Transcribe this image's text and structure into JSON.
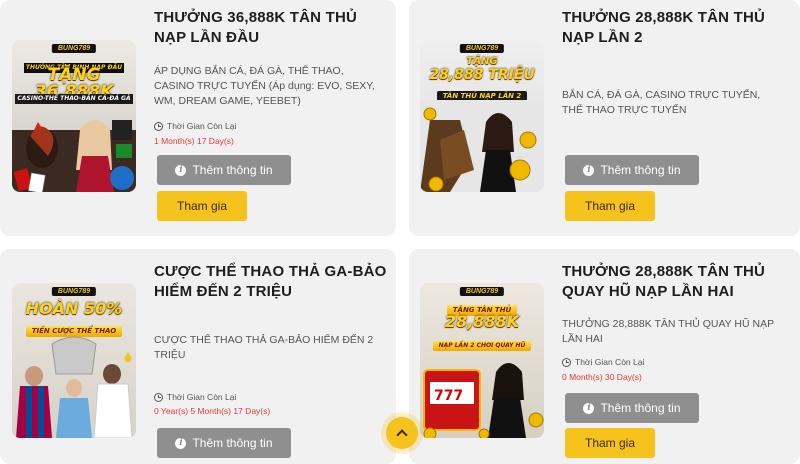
{
  "promotions": [
    {
      "title": "THƯỞNG 36,888K TÂN THỦ NẠP LẦN ĐẦU",
      "description": "ÁP DỤNG BẮN CÁ, ĐÁ GÀ, THỂ THAO, CASINO TRỰC TUYẾN (Áp dụng: EVO, SEXY, WM, DREAM GAME, YEEBET)",
      "timer_label": "Thời Gian Còn Lại",
      "timer_value": "1 Month(s) 17 Day(s)",
      "info_button": "Thêm thông tin",
      "join_button": "Tham gia",
      "image": {
        "logo": "BUNG789",
        "top_line": "THƯỞNG TÂN BINH NẠP ĐẦU",
        "headline": "TẶNG 36,888K",
        "sub_line": "CASINO-THỂ THAO-BẮN CÁ-ĐÁ GÀ"
      }
    },
    {
      "title": "THƯỞNG 28,888K TÂN THỦ NẠP LẦN 2",
      "description": "BẮN CÁ, ĐÁ GÀ, CASINO TRỰC TUYẾN, THỂ THAO TRỰC TUYẾN",
      "info_button": "Thêm thông tin",
      "join_button": "Tham gia",
      "image": {
        "logo": "BUNG789",
        "top_line": "TẶNG",
        "headline": "28,888 TRIỆU",
        "sub_line": "TÂN THỦ NẠP LẦN 2"
      }
    },
    {
      "title": "CƯỢC THỂ THAO THẢ GA-BẢO HIỂM ĐẾN 2 TRIỆU",
      "description": "CƯỢC THỂ THAO THẢ GA-BẢO HIỂM ĐẾN 2 TRIỆU",
      "timer_label": "Thời Gian Còn Lại",
      "timer_value": "0 Year(s) 5 Month(s) 17 Day(s)",
      "info_button": "Thêm thông tin",
      "image": {
        "logo": "BUNG789",
        "headline": "HOÀN 50%",
        "sub_line": "TIỀN CƯỢC THỂ THAO"
      }
    },
    {
      "title": "THƯỞNG 28,888K TÂN THỦ QUAY HŨ NẠP LẦN HAI",
      "description": "THƯỞNG 28,888K TÂN THỦ QUAY HŨ NẠP LẦN HAI",
      "timer_label": "Thời Gian Còn Lại",
      "timer_value": "0 Month(s) 30 Day(s)",
      "info_button": "Thêm thông tin",
      "join_button": "Tham gia",
      "image": {
        "logo": "BUNG789",
        "top_line": "TẶNG TÂN THỦ",
        "headline": "28,888K",
        "sub_line": "NẠP LẦN 2 CHƠI QUAY HŨ"
      }
    }
  ],
  "colors": {
    "card_bg": "#f1f1f1",
    "info_button": "#8f8f8f",
    "join_button": "#f6c21c",
    "timer_value": "#e53935"
  },
  "scroll_top": {
    "icon": "chevron-up-icon"
  }
}
